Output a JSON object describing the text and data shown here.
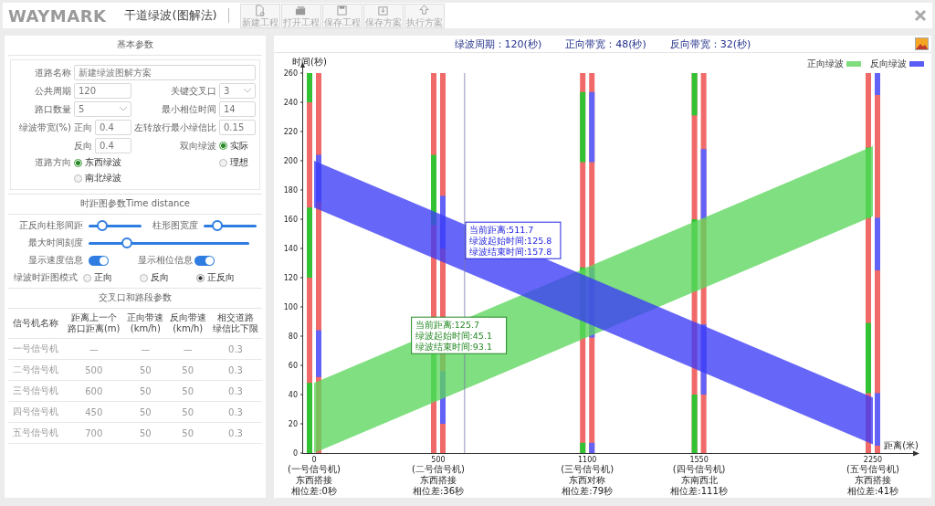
{
  "app": {
    "logo": "WAYMARK",
    "title": "干道绿波(图解法)",
    "toolbar": [
      {
        "label": "新建工程",
        "disabled": true
      },
      {
        "label": "打开工程",
        "disabled": true
      },
      {
        "label": "保存工程",
        "disabled": true
      },
      {
        "label": "保存方案",
        "disabled": true
      },
      {
        "label": "执行方案",
        "disabled": true
      }
    ]
  },
  "basic_params": {
    "title": "基本参数",
    "road_name": {
      "label": "道路名称",
      "value": "新建绿波图解方案"
    },
    "cycle": {
      "label": "公共周期",
      "value": "120"
    },
    "key_intersection": {
      "label": "关键交叉口",
      "value": "3"
    },
    "intersection_count": {
      "label": "路口数量",
      "value": "5"
    },
    "min_phase": {
      "label": "最小相位时间",
      "value": "14"
    },
    "bandwidth": {
      "label": "绿波带宽(%)",
      "forward_label": "正向",
      "forward": "0.4",
      "reverse_label": "反向",
      "reverse": "0.4"
    },
    "left_turn": {
      "label": "左转放行最小绿信比",
      "value": "0.15"
    },
    "two_way": {
      "label": "双向绿波",
      "options": [
        {
          "label": "实际",
          "selected": true
        },
        {
          "label": "理想",
          "selected": false
        }
      ]
    },
    "direction": {
      "label": "道路方向",
      "options": [
        {
          "label": "东西绿波",
          "selected": true
        },
        {
          "label": "南北绿波",
          "selected": false
        }
      ]
    }
  },
  "diagram_params": {
    "title": "时距图参数Time distance",
    "sliders": [
      {
        "label": "正反向柱形间距",
        "level": 0.25
      },
      {
        "label": "柱形图宽度",
        "level": 0.25
      },
      {
        "label": "最大时间刻度",
        "level": 0.24
      }
    ],
    "toggles": [
      {
        "label": "显示速度信息",
        "on": true
      },
      {
        "label": "显示相位信息",
        "on": true
      }
    ],
    "mode": {
      "label": "绿波时距图模式",
      "options": [
        {
          "label": "正向",
          "selected": false
        },
        {
          "label": "反向",
          "selected": false
        },
        {
          "label": "正反向",
          "selected": true
        }
      ]
    }
  },
  "intersection_params": {
    "title": "交叉口和路段参数",
    "columns": [
      {
        "lines": [
          "信号机名称"
        ]
      },
      {
        "lines": [
          "距离上一个",
          "路口距离(m)"
        ]
      },
      {
        "lines": [
          "正向带速",
          "(km/h)"
        ]
      },
      {
        "lines": [
          "反向带速",
          "(km/h)"
        ]
      },
      {
        "lines": [
          "相交道路",
          "绿信比下限"
        ]
      }
    ],
    "rows": [
      [
        "一号信号机",
        "—",
        "—",
        "—",
        "0.3"
      ],
      [
        "二号信号机",
        "500",
        "50",
        "50",
        "0.3"
      ],
      [
        "三号信号机",
        "600",
        "50",
        "50",
        "0.3"
      ],
      [
        "四号信号机",
        "450",
        "50",
        "50",
        "0.3"
      ],
      [
        "五号信号机",
        "700",
        "50",
        "50",
        "0.3"
      ]
    ]
  },
  "time_distance_chart": {
    "summary": [
      "绿波周期：120(秒)",
      "正向带宽：48(秒)",
      "反向带宽：32(秒)"
    ],
    "y_title": "时间(秒)",
    "x_title": "距离(米)",
    "legend": [
      {
        "label": "正向绿波",
        "color": "#7fdc7f"
      },
      {
        "label": "反向绿波",
        "color": "#5b5bf5"
      }
    ],
    "yticks": [
      "260",
      "240",
      "220",
      "200",
      "180",
      "160",
      "140",
      "120",
      "100",
      "80",
      "60",
      "40",
      "20",
      "0"
    ],
    "intersections": [
      {
        "distance": "0",
        "name": "(一号信号机)",
        "mode": "东西搭接",
        "offset_text": "相位差:0秒"
      },
      {
        "distance": "500",
        "name": "(二号信号机)",
        "mode": "东西搭接",
        "offset_text": "相位差:36秒"
      },
      {
        "distance": "1100",
        "name": "(三号信号机)",
        "mode": "东西对称",
        "offset_text": "相位差:79秒"
      },
      {
        "distance": "1550",
        "name": "(四号信号机)",
        "mode": "东南西北",
        "offset_text": "相位差:111秒"
      },
      {
        "distance": "2250",
        "name": "(五号信号机)",
        "mode": "东西搭接",
        "offset_text": "相位差:41秒"
      }
    ],
    "bands": [
      {
        "kind": "forward",
        "color": "#5cd65c"
      },
      {
        "kind": "reverse",
        "color": "#3b3bf7"
      }
    ],
    "tooltips": [
      {
        "kind": "reverse",
        "lines": [
          "当前距离:511.7",
          "绿波起始时间:125.8",
          "绿波结束时间:157.8"
        ]
      },
      {
        "kind": "forward",
        "lines": [
          "当前距离:125.7",
          "绿波起始时间:45.1",
          "绿波结束时间:93.1"
        ]
      }
    ]
  }
}
